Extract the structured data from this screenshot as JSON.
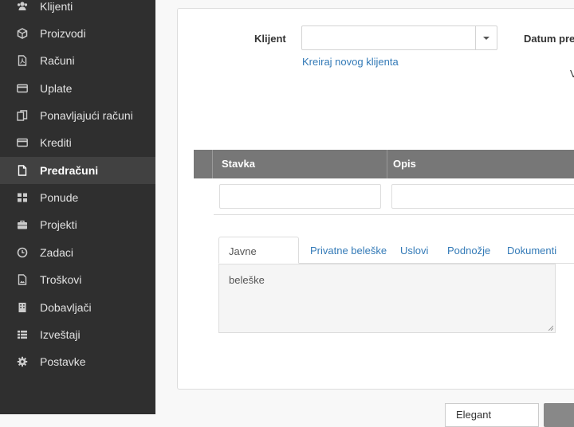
{
  "sidebar": {
    "items": [
      {
        "label": "Klijenti",
        "icon": "users-icon"
      },
      {
        "label": "Proizvodi",
        "icon": "cube-icon"
      },
      {
        "label": "Računi",
        "icon": "file-pdf-icon"
      },
      {
        "label": "Uplate",
        "icon": "credit-card-icon"
      },
      {
        "label": "Ponavljajući računi",
        "icon": "files-icon"
      },
      {
        "label": "Krediti",
        "icon": "credit-card-icon"
      },
      {
        "label": "Predračuni",
        "icon": "file-icon",
        "active": true
      },
      {
        "label": "Ponude",
        "icon": "grid-icon"
      },
      {
        "label": "Projekti",
        "icon": "briefcase-icon"
      },
      {
        "label": "Zadaci",
        "icon": "clock-icon"
      },
      {
        "label": "Troškovi",
        "icon": "image-file-icon"
      },
      {
        "label": "Dobavljači",
        "icon": "building-icon"
      },
      {
        "label": "Izveštaji",
        "icon": "list-icon"
      },
      {
        "label": "Postavke",
        "icon": "gear-icon"
      }
    ]
  },
  "form": {
    "client_label": "Klijent",
    "client_value": "",
    "create_client_link": "Kreiraj novog klijenta",
    "date_label": "Datum pred",
    "stray_text": "V"
  },
  "table": {
    "headers": [
      "Stavka",
      "Opis"
    ]
  },
  "tabs": [
    {
      "label": "Javne beleške",
      "active": true
    },
    {
      "label": "Privatne beleške"
    },
    {
      "label": "Uslovi"
    },
    {
      "label": "Podnožje"
    },
    {
      "label": "Dokumenti"
    }
  ],
  "notes_value": "",
  "footer": {
    "design_select": "Elegant"
  },
  "colors": {
    "sidebar_bg": "#2f2f2f",
    "sidebar_active": "#414141",
    "link": "#337ab7",
    "table_header": "#777777"
  }
}
